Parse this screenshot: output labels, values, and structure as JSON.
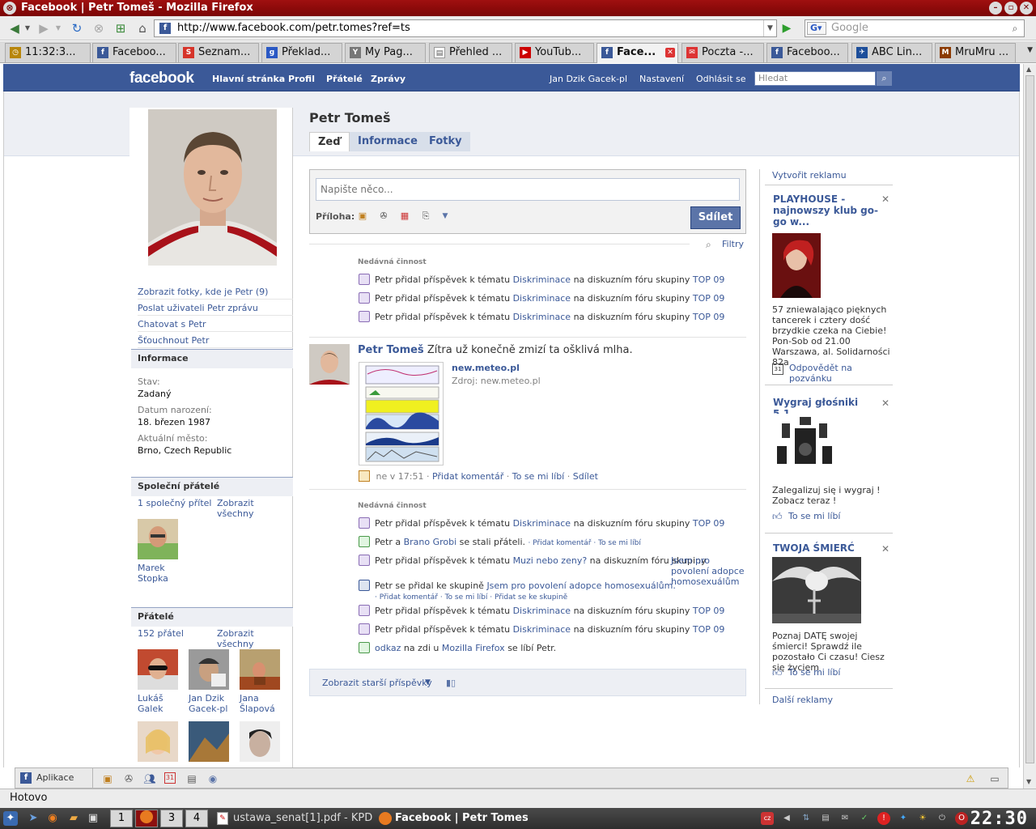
{
  "window": {
    "title": "Facebook | Petr Tomeš - Mozilla Firefox"
  },
  "browser": {
    "url": "http://www.facebook.com/petr.tomes?ref=ts",
    "search_placeholder": "Google",
    "status": "Hotovo",
    "tabs": [
      {
        "label": "11:32:3...",
        "icon": "clock-icon"
      },
      {
        "label": "Faceboo...",
        "icon": "facebook-icon"
      },
      {
        "label": "Seznam...",
        "icon": "seznam-icon"
      },
      {
        "label": "Překlad...",
        "icon": "google-icon"
      },
      {
        "label": "My Pag...",
        "icon": "page-icon"
      },
      {
        "label": "Přehled ...",
        "icon": "document-icon"
      },
      {
        "label": "YouTub...",
        "icon": "youtube-icon"
      },
      {
        "label": "Face...",
        "icon": "facebook-icon",
        "active": true
      },
      {
        "label": "Poczta -...",
        "icon": "mail-icon"
      },
      {
        "label": "Faceboo...",
        "icon": "facebook-icon"
      },
      {
        "label": "ABC Lin...",
        "icon": "linux-icon"
      },
      {
        "label": "MruMru ...",
        "icon": "game-icon"
      }
    ]
  },
  "fb": {
    "logo": "facebook",
    "nav": {
      "home": "Hlavní stránka",
      "profile": "Profil",
      "friends": "Přátelé",
      "messages": "Zprávy"
    },
    "account": {
      "user": "Jan Dzik Gacek-pl",
      "settings": "Nastavení",
      "logout": "Odhlásit se"
    },
    "search_placeholder": "Hledat"
  },
  "profile": {
    "name": "Petr Tomeš",
    "tabs": {
      "wall": "Zeď",
      "info": "Informace",
      "photos": "Fotky"
    },
    "actions": {
      "photos_of": "Zobrazit fotky, kde je Petr (9)",
      "send_message": "Poslat uživateli Petr zprávu",
      "chat": "Chatovat s Petr",
      "poke": "Šťouchnout Petr"
    },
    "info": {
      "heading": "Informace",
      "status_label": "Stav:",
      "status_value": "Zadaný",
      "birthday_label": "Datum narození:",
      "birthday_value": "18. březen 1987",
      "city_label": "Aktuální město:",
      "city_value": "Brno, Czech Republic"
    },
    "mutual": {
      "heading": "Společní přátelé",
      "count": "1 společný přítel",
      "show_all": "Zobrazit všechny",
      "friends": [
        {
          "name": "Marek Stopka"
        }
      ]
    },
    "friends": {
      "heading": "Přátelé",
      "count": "152 přátel",
      "show_all": "Zobrazit všechny",
      "list": [
        {
          "name": "Lukáš Galek"
        },
        {
          "name": "Jan Dzik Gacek-pl"
        },
        {
          "name": "Jana Šlapová"
        }
      ]
    }
  },
  "composer": {
    "placeholder": "Napište něco...",
    "attach_label": "Příloha:",
    "share": "Sdílet"
  },
  "filters": "Filtry",
  "feed": {
    "recent_label": "Nedávná činnost",
    "group1": [
      {
        "a": "Petr přidal příspěvek k tématu ",
        "topic": "Diskriminace",
        "b": " na diskuzním fóru skupiny ",
        "group": "TOP 09"
      },
      {
        "a": "Petr přidal příspěvek k tématu ",
        "topic": "Diskriminace",
        "b": " na diskuzním fóru skupiny ",
        "group": "TOP 09"
      },
      {
        "a": "Petr přidal příspěvek k tématu ",
        "topic": "Diskriminace",
        "b": " na diskuzním fóru skupiny ",
        "group": "TOP 09"
      }
    ],
    "post": {
      "author": "Petr Tomeš",
      "text": "Zítra už konečně zmizí ta ošklivá mlha.",
      "link_title": "new.meteo.pl",
      "link_source": "Zdroj: new.meteo.pl",
      "time": "ne v 17:51",
      "comment": "Přidat komentář",
      "like": "To se mi líbí",
      "share": "Sdílet"
    },
    "group2": {
      "r1": {
        "a": "Petr přidal příspěvek k tématu ",
        "topic": "Diskriminace",
        "b": " na diskuzním fóru skupiny ",
        "group": "TOP 09"
      },
      "r2": {
        "a": "Petr a ",
        "friend": "Brano Grobi",
        "b": " se stali přáteli.",
        "comment": "Přidat komentář",
        "like": "To se mi líbí"
      },
      "r3": {
        "a": "Petr přidal příspěvek k tématu ",
        "topic": "Muzi nebo zeny?",
        "b": " na diskuzním fóru skupiny ",
        "group": "Jsem pro povolení adopce homosexuálům"
      },
      "r4": {
        "a": "Petr se přidal ke skupině ",
        "group": "Jsem pro povolení adopce homosexuálům.",
        "comment": "Přidat komentář",
        "like": "To se mi líbí",
        "join": "Přidat se ke skupině"
      },
      "r5": {
        "a": "Petr přidal příspěvek k tématu ",
        "topic": "Diskriminace",
        "b": " na diskuzním fóru skupiny ",
        "group": "TOP 09"
      },
      "r6": {
        "a": "Petr přidal příspěvek k tématu ",
        "topic": "Diskriminace",
        "b": " na diskuzním fóru skupiny ",
        "group": "TOP 09"
      },
      "r7": {
        "link": "odkaz",
        "a": " na zdi u ",
        "target": "Mozilla Firefox",
        "b": " se líbí Petr."
      }
    },
    "older": "Zobrazit starší příspěvky"
  },
  "ads": {
    "create": "Vytvořit reklamu",
    "ad1": {
      "title": "PLAYHOUSE - najnowszy klub go-go w...",
      "text": "57 zniewalająco pięknych tancerek i cztery dość brzydkie czeka na Ciebie! Pon-Sob od 21.00 Warszawa, al. Solidarności 82a",
      "action": "Odpovědět na pozvánku"
    },
    "ad2": {
      "title": "Wygraj głośniki 5.1",
      "text": "Zalegalizuj się i wygraj ! Zobacz teraz !",
      "action": "To se mi líbí"
    },
    "ad3": {
      "title": "TWOJA ŚMIERĆ",
      "text": "Poznaj DATĘ swojej śmierci! Sprawdź ile pozostało Ci czasu! Ciesz się życiem",
      "action": "To se mi líbí"
    },
    "more": "Další reklamy"
  },
  "bottombar": {
    "apps": "Aplikace"
  },
  "taskbar": {
    "desktops": [
      "1",
      "2",
      "3",
      "4"
    ],
    "tasks": [
      {
        "label": "ustawa_senat[1].pdf - KPD"
      },
      {
        "label": "Facebook | Petr Tomes",
        "active": true
      }
    ],
    "clock": "22:30"
  }
}
